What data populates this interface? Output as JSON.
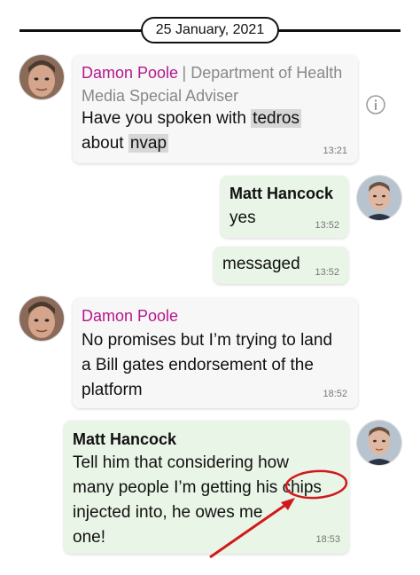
{
  "date_divider": "25 January, 2021",
  "messages": [
    {
      "sender": "Damon Poole",
      "sender_suffix": "| Department of Health Media Special Adviser",
      "pre": "Have you spoken with ",
      "hl1": "tedros",
      "mid": "about ",
      "hl2": "nvap",
      "time": "13:21"
    },
    {
      "sender": "Matt Hancock",
      "text": "yes",
      "time": "13:52"
    },
    {
      "text": "messaged",
      "time": "13:52"
    },
    {
      "sender": "Damon Poole",
      "line1": "No promises but I’m trying to land",
      "line2": "a Bill gates endorsement of the",
      "line3": "platform",
      "time": "18:52"
    },
    {
      "sender": "Matt Hancock",
      "line1": "Tell him that considering how",
      "line2": "many people I’m getting his chips",
      "line3": "injected into, he owes me",
      "line4": "one!",
      "time": "18:53"
    }
  ],
  "colors": {
    "sender_in": "#b5178c",
    "bubble_in": "#f7f7f7",
    "bubble_out": "#e9f5e6",
    "annotation": "#d0191e"
  },
  "icons": {
    "info": "info-icon"
  }
}
